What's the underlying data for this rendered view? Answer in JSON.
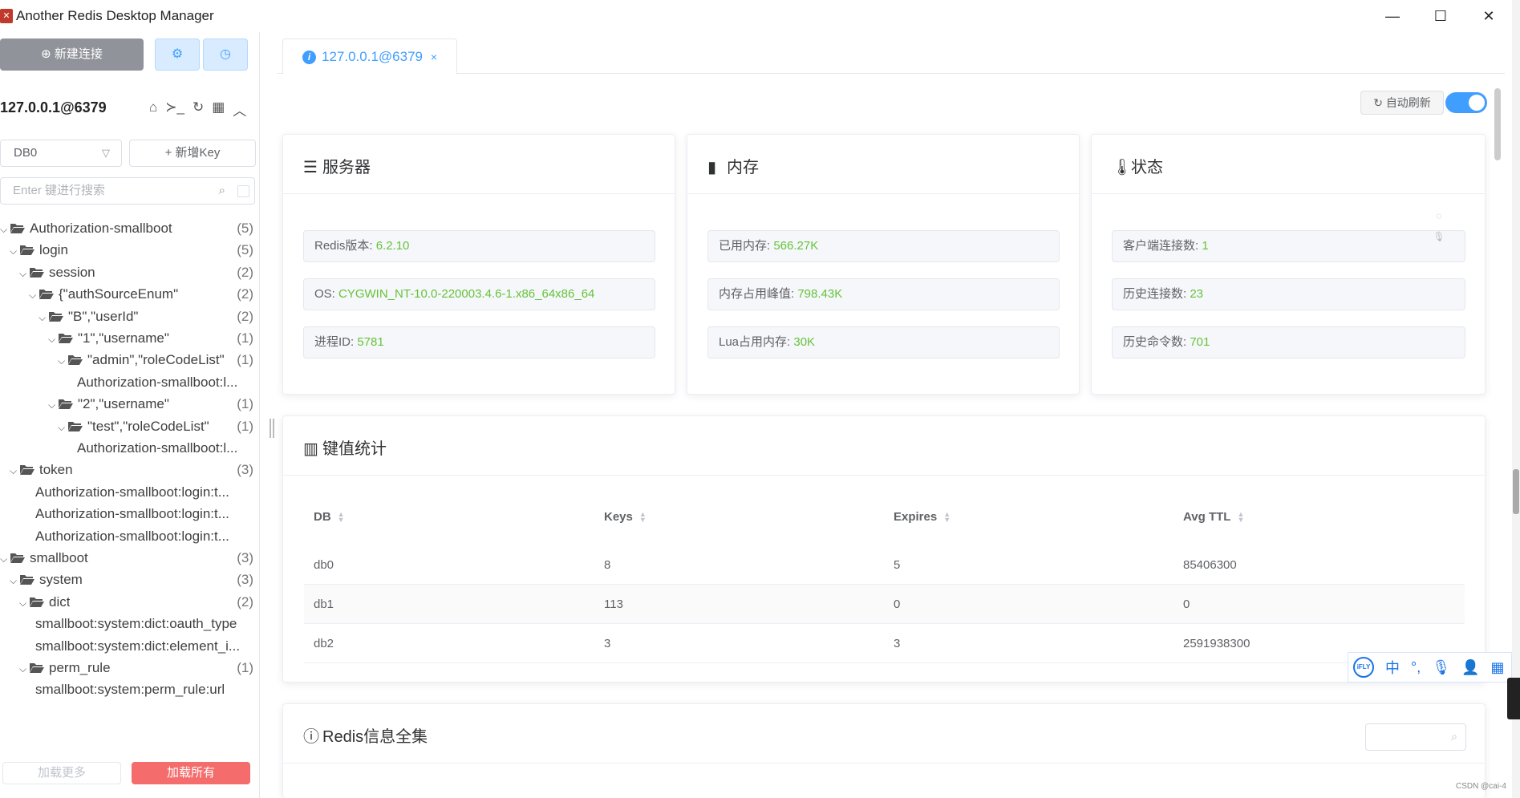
{
  "window": {
    "title": "Another Redis Desktop Manager",
    "minimize": "—",
    "maximize": "☐",
    "close": "✕"
  },
  "sidebar": {
    "new_connection": "新建连接",
    "connection_name": "127.0.0.1@6379",
    "db_select": "DB0",
    "add_key": "+ 新增Key",
    "search_placeholder": "Enter 键进行搜索",
    "load_more": "加载更多",
    "load_all": "加载所有",
    "tree": [
      {
        "label": "Authorization-smallboot",
        "count": "(5)",
        "caret": "⌄",
        "folder": true
      },
      {
        "label": "login",
        "count": "(5)",
        "caret": "⌄",
        "folder": true
      },
      {
        "label": "session",
        "count": "(2)",
        "caret": "⌄",
        "folder": true
      },
      {
        "label": "{\"authSourceEnum\"",
        "count": "(2)",
        "caret": "⌄",
        "folder": true
      },
      {
        "label": "\"B\",\"userId\"",
        "count": "(2)",
        "caret": "⌄",
        "folder": true
      },
      {
        "label": "\"1\",\"username\"",
        "count": "(1)",
        "caret": "⌄",
        "folder": true
      },
      {
        "label": "\"admin\",\"roleCodeList\"",
        "count": "(1)",
        "caret": "⌄",
        "folder": true
      },
      {
        "label": "Authorization-smallboot:l...",
        "count": "",
        "caret": "",
        "folder": false
      },
      {
        "label": "\"2\",\"username\"",
        "count": "(1)",
        "caret": "⌄",
        "folder": true
      },
      {
        "label": "\"test\",\"roleCodeList\"",
        "count": "(1)",
        "caret": "⌄",
        "folder": true
      },
      {
        "label": "Authorization-smallboot:l...",
        "count": "",
        "caret": "",
        "folder": false
      },
      {
        "label": "token",
        "count": "(3)",
        "caret": "⌄",
        "folder": true
      },
      {
        "label": "Authorization-smallboot:login:t...",
        "count": "",
        "caret": "",
        "folder": false
      },
      {
        "label": "Authorization-smallboot:login:t...",
        "count": "",
        "caret": "",
        "folder": false
      },
      {
        "label": "Authorization-smallboot:login:t...",
        "count": "",
        "caret": "",
        "folder": false
      },
      {
        "label": "smallboot",
        "count": "(3)",
        "caret": "⌄",
        "folder": true
      },
      {
        "label": "system",
        "count": "(3)",
        "caret": "⌄",
        "folder": true
      },
      {
        "label": "dict",
        "count": "(2)",
        "caret": "⌄",
        "folder": true
      },
      {
        "label": "smallboot:system:dict:oauth_type",
        "count": "",
        "caret": "",
        "folder": false
      },
      {
        "label": "smallboot:system:dict:element_i...",
        "count": "",
        "caret": "",
        "folder": false
      },
      {
        "label": "perm_rule",
        "count": "(1)",
        "caret": "⌄",
        "folder": true
      },
      {
        "label": "smallboot:system:perm_rule:url",
        "count": "",
        "caret": "",
        "folder": false
      }
    ]
  },
  "tab": {
    "label": "127.0.0.1@6379",
    "close": "×"
  },
  "toolbar": {
    "auto_refresh": "自动刷新",
    "auto_refresh_on": true
  },
  "server": {
    "title": "服务器",
    "rows": [
      {
        "label": "Redis版本: ",
        "value": "6.2.10"
      },
      {
        "label": "OS: ",
        "value": "CYGWIN_NT-10.0-220003.4.6-1.x86_64x86_64"
      },
      {
        "label": "进程ID: ",
        "value": "5781"
      }
    ]
  },
  "memory": {
    "title": "内存",
    "rows": [
      {
        "label": "已用内存: ",
        "value": "566.27K"
      },
      {
        "label": "内存占用峰值: ",
        "value": "798.43K"
      },
      {
        "label": "Lua占用内存: ",
        "value": "30K"
      }
    ]
  },
  "status": {
    "title": "状态",
    "rows": [
      {
        "label": "客户端连接数: ",
        "value": "1"
      },
      {
        "label": "历史连接数: ",
        "value": "23"
      },
      {
        "label": "历史命令数: ",
        "value": "701"
      }
    ]
  },
  "keystats": {
    "title": "键值统计",
    "columns": [
      "DB",
      "Keys",
      "Expires",
      "Avg TTL"
    ],
    "rows": [
      [
        "db0",
        "8",
        "5",
        "85406300"
      ],
      [
        "db1",
        "113",
        "0",
        "0"
      ],
      [
        "db2",
        "3",
        "3",
        "2591938300"
      ]
    ]
  },
  "redis_info": {
    "title": "Redis信息全集"
  },
  "ime": {
    "logo": "iFLY",
    "lang": "中",
    "punct": "°,"
  },
  "watermark": "CSDN @cai-4",
  "colors": {
    "accent": "#409eff",
    "value_green": "#67c23a",
    "danger": "#f56c6c"
  }
}
